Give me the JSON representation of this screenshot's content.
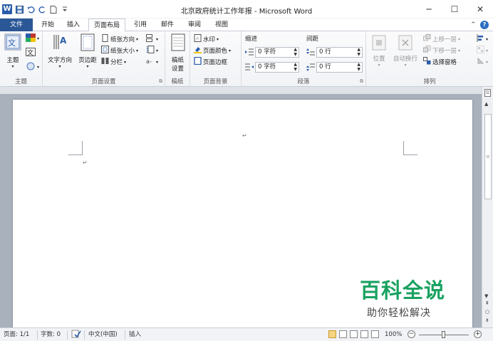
{
  "titlebar": {
    "app_letter": "W",
    "title": "北京政府统计工作年报 - Microsoft Word",
    "minimize": "─",
    "maximize": "☐",
    "close": "✕"
  },
  "tabs": {
    "file": "文件",
    "home": "开始",
    "insert": "插入",
    "page_layout": "页面布局",
    "references": "引用",
    "mailings": "邮件",
    "review": "审阅",
    "view": "视图"
  },
  "ribbon": {
    "themes": {
      "label": "主题",
      "themes_btn": "主题",
      "text_dir": "文字方向",
      "margins": "页边距"
    },
    "page_setup": {
      "label": "页面设置",
      "orientation": "纸张方向",
      "size": "纸张大小",
      "columns": "分栏"
    },
    "paper": {
      "label": "稿纸",
      "btn_line1": "稿纸",
      "btn_line2": "设置"
    },
    "page_background": {
      "label": "页面背景",
      "watermark": "水印",
      "page_color": "页面颜色",
      "page_borders": "页面边框"
    },
    "paragraph": {
      "label": "段落",
      "indent_head": "缩进",
      "spacing_head": "间距",
      "indent_left": "0 字符",
      "indent_right": "0 字符",
      "spacing_before": "0 行",
      "spacing_after": "0 行"
    },
    "arrange": {
      "label": "排列",
      "position": "位置",
      "wrap_text": "自动换行",
      "bring_forward": "上移一层",
      "send_backward": "下移一层",
      "selection_pane": "选择窗格"
    }
  },
  "document": {
    "paragraph_mark": "↵"
  },
  "watermark": {
    "title": "百科全说",
    "subtitle": "助你轻松解决"
  },
  "statusbar": {
    "page": "页面: 1/1",
    "words": "字数: 0",
    "language": "中文(中国)",
    "mode": "插入",
    "zoom": "100%"
  },
  "colors": {
    "file_tab": "#2b5797",
    "watermark_green": "#1aa260",
    "doc_background": "#a9b1bc"
  }
}
